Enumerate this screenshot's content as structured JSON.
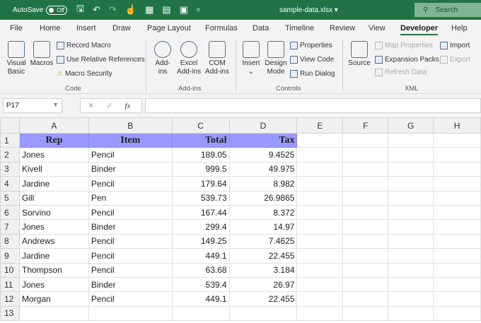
{
  "titlebar": {
    "autosave": "AutoSave",
    "toggle": "Off",
    "filename": "sample-data.xlsx",
    "search": "Search"
  },
  "tabs": [
    "File",
    "Home",
    "Insert",
    "Draw",
    "Page Layout",
    "Formulas",
    "Data",
    "Timeline",
    "Review",
    "View",
    "Developer",
    "Help"
  ],
  "ribbon": {
    "code": {
      "visual_basic": "Visual Basic",
      "macros": "Macros",
      "record_macro": "Record Macro",
      "relative": "Use Relative References",
      "security": "Macro Security",
      "label": "Code"
    },
    "addins": {
      "addins": "Add-ins",
      "excel": "Excel Add-ins",
      "com": "COM Add-ins",
      "label": "Add-ins"
    },
    "controls": {
      "insert": "Insert",
      "design": "Design Mode",
      "properties": "Properties",
      "view_code": "View Code",
      "run_dialog": "Run Dialog",
      "label": "Controls"
    },
    "xml": {
      "source": "Source",
      "map": "Map Properties",
      "expansion": "Expansion Packs",
      "refresh": "Refresh Data",
      "import": "Import",
      "export": "Export",
      "label": "XML"
    }
  },
  "formula_bar": {
    "name_box": "P17",
    "fx": "fx",
    "value": ""
  },
  "columns": [
    "A",
    "B",
    "C",
    "D",
    "E",
    "F",
    "G",
    "H"
  ],
  "header": [
    "Rep",
    "Item",
    "Total",
    "Tax"
  ],
  "rows": [
    [
      "Jones",
      "Pencil",
      "189.05",
      "9.4525"
    ],
    [
      "Kivell",
      "Binder",
      "999.5",
      "49.975"
    ],
    [
      "Jardine",
      "Pencil",
      "179.64",
      "8.982"
    ],
    [
      "Gill",
      "Pen",
      "539.73",
      "26.9865"
    ],
    [
      "Sorvino",
      "Pencil",
      "167.44",
      "8.372"
    ],
    [
      "Jones",
      "Binder",
      "299.4",
      "14.97"
    ],
    [
      "Andrews",
      "Pencil",
      "149.25",
      "7.4625"
    ],
    [
      "Jardine",
      "Pencil",
      "449.1",
      "22.455"
    ],
    [
      "Thompson",
      "Pencil",
      "63.68",
      "3.184"
    ],
    [
      "Jones",
      "Binder",
      "539.4",
      "26.97"
    ],
    [
      "Morgan",
      "Pencil",
      "449.1",
      "22.455"
    ]
  ],
  "row_numbers": [
    "1",
    "2",
    "3",
    "4",
    "5",
    "6",
    "7",
    "8",
    "9",
    "10",
    "11",
    "12",
    "13"
  ]
}
